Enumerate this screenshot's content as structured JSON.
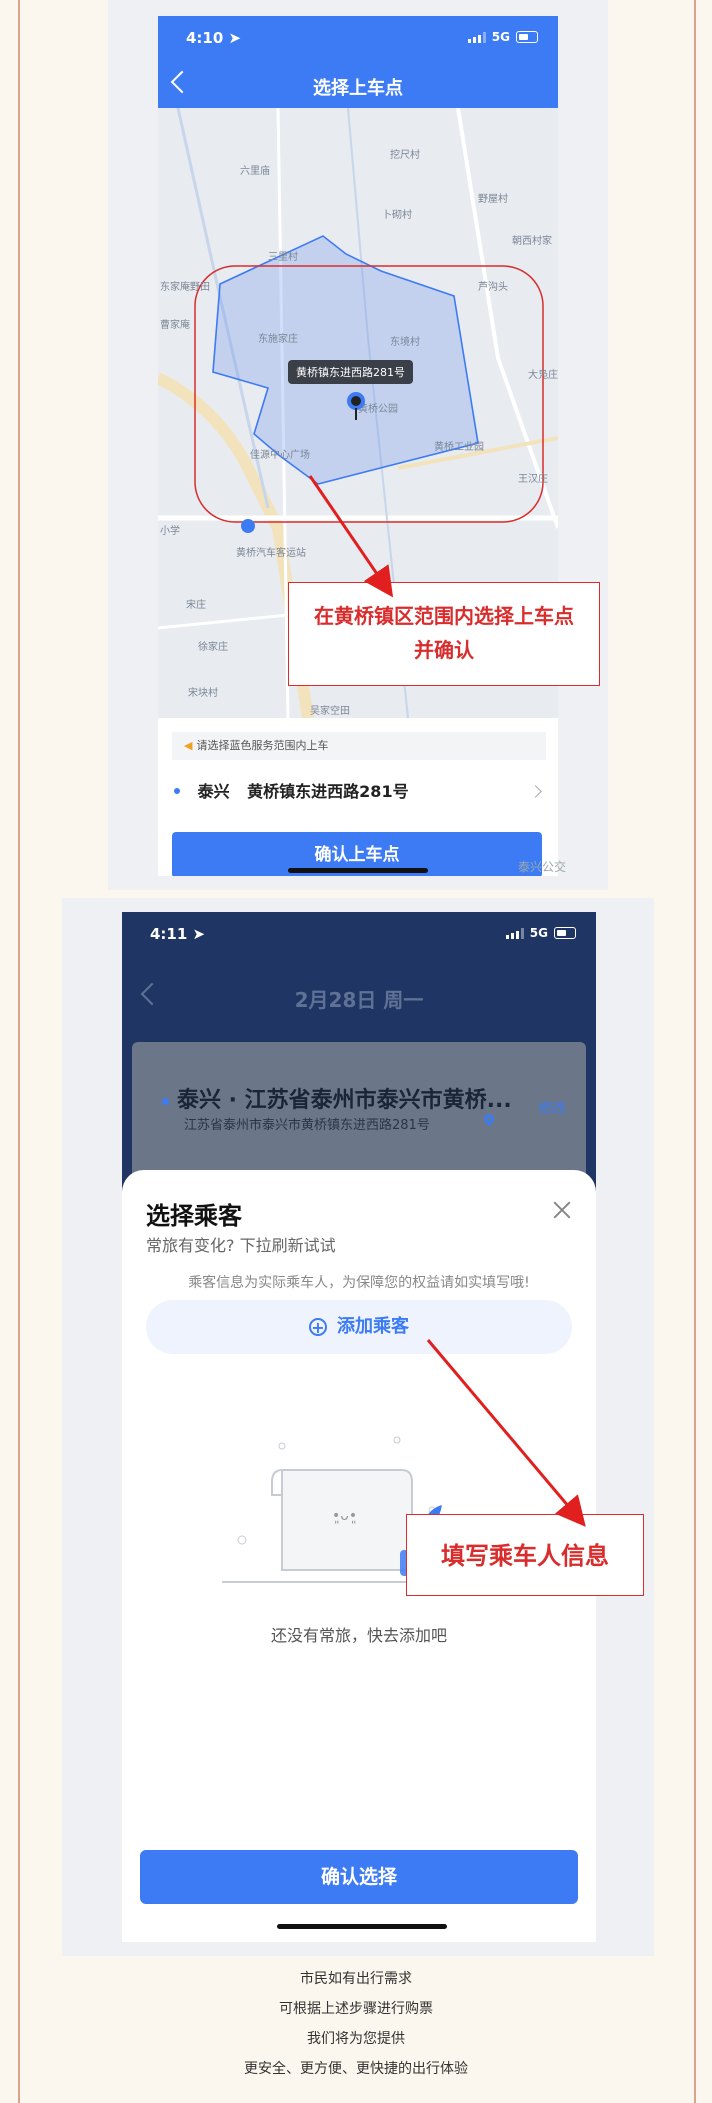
{
  "screen1": {
    "status_time": "4:10",
    "network": "5G",
    "nav_title": "选择上车点",
    "map_places": [
      "六里庙",
      "挖尺村",
      "野屋村",
      "卜砌村",
      "三里村",
      "朝西村家",
      "东家庵野田",
      "曹家庵",
      "芦沟头",
      "东施家庄",
      "东境村",
      "大凫庄",
      "黄桥公园",
      "佳源中心广场",
      "黄桥工业园",
      "王汉庄",
      "小学",
      "黄桥汽车客运站",
      "宋庄",
      "徐家庄",
      "宋块村",
      "吴家空田"
    ],
    "pin_label": "黄桥镇东进西路281号",
    "annotation": [
      "在黄桥镇区范围内选择上车点",
      "并确认"
    ],
    "notice": "请选择蓝色服务范围内上车",
    "address_city": "泰兴",
    "address": "黄桥镇东进西路281号",
    "confirm_button": "确认上车点",
    "watermark": "泰兴公交"
  },
  "screen2": {
    "status_time": "4:11",
    "network": "5G",
    "nav_title": "2月28日 周一",
    "card_line1": "泰兴 · 江苏省泰州市泰兴市黄桥...",
    "card_line2": "江苏省泰州市泰兴市黄桥镇东进西路281号",
    "card_edit": "修改",
    "sheet_title": "选择乘客",
    "sheet_subtitle": "常旅有变化? 下拉刷新试试",
    "sheet_tip": "乘客信息为实际乘车人，为保障您的权益请如实填写哦!",
    "add_passenger": "添加乘客",
    "empty_text": "还没有常旅，快去添加吧",
    "confirm_button": "确认选择",
    "annotation": "填写乘车人信息"
  },
  "footer": [
    "市民如有出行需求",
    "可根据上述步骤进行购票",
    "我们将为您提供",
    "更安全、更方便、更快捷的出行体验"
  ],
  "colors": {
    "brand_blue": "#3d7bf4",
    "annotation_red": "#d92c2c"
  },
  "icons": [
    "location-arrow-icon",
    "signal-icon",
    "battery-icon",
    "back-chevron-icon",
    "speaker-icon",
    "chevron-right-icon",
    "map-pin-icon",
    "close-icon",
    "plus-circle-icon",
    "location-icon"
  ]
}
